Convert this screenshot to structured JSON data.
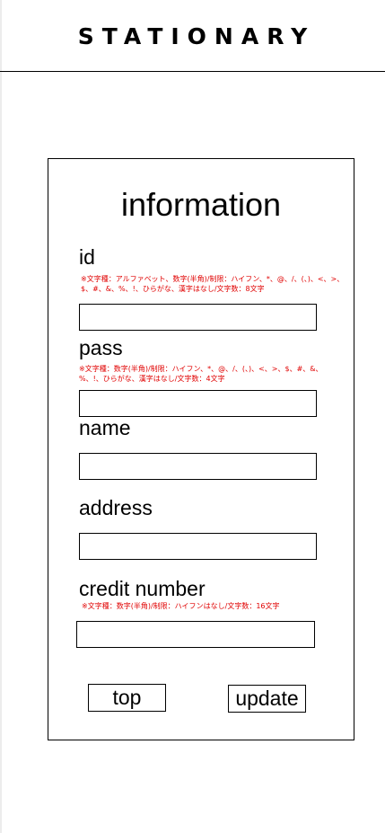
{
  "header": {
    "brand": "STATIONARY"
  },
  "form": {
    "title": "information",
    "id": {
      "label": "id",
      "note": "※文字種：アルファベット、数字(半角)/制限：ハイフン、*、@、/、(、)、<、>、$、#、&、%、!、ひらがな、漢字はなし/文字数：8文字",
      "value": ""
    },
    "pass": {
      "label": "pass",
      "note": "※文字種：数字(半角)/制限：ハイフン、*、@、/、(、)、<、>、$、#、&、%、!、ひらがな、漢字はなし/文字数：4文字",
      "value": ""
    },
    "name": {
      "label": "name",
      "value": ""
    },
    "address": {
      "label": "address",
      "value": ""
    },
    "credit": {
      "label": "credit number",
      "note": "※文字種：数字(半角)/制限：ハイフンはなし/文字数：16文字",
      "value": ""
    },
    "buttons": {
      "top": "top",
      "update": "update"
    }
  }
}
